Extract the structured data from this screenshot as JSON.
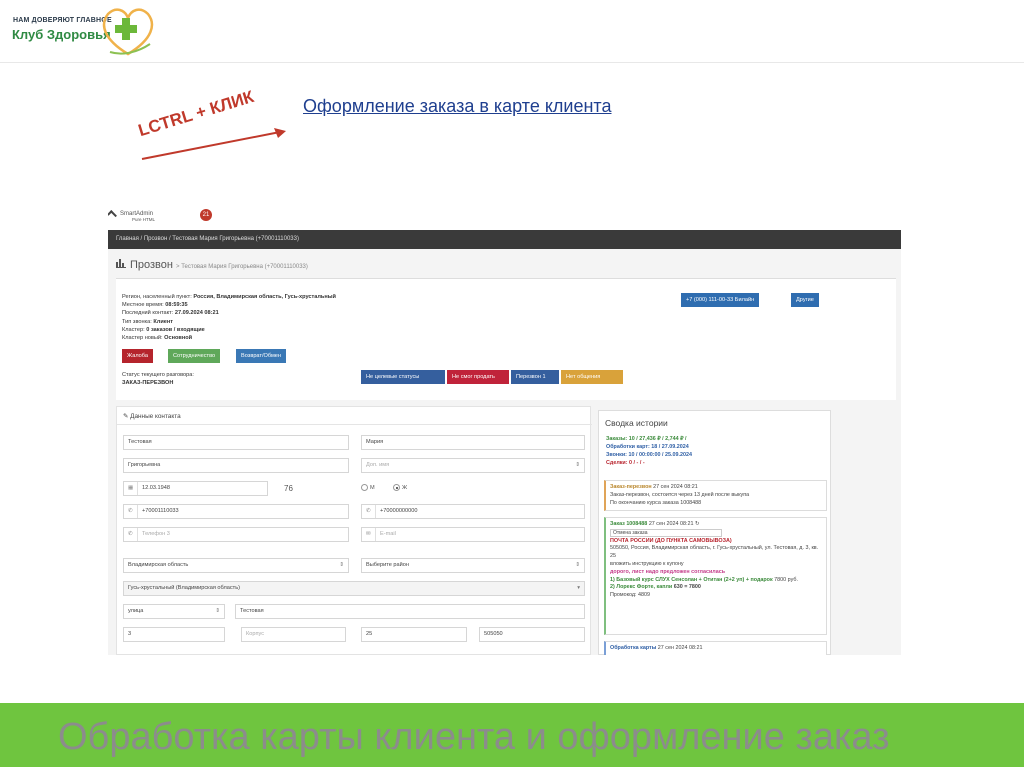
{
  "logo": {
    "top_line": "НАМ ДОВЕРЯЮТ ГЛАВНОЕ",
    "name": "Клуб Здоровья"
  },
  "slide": {
    "link_text": "Оформление заказа в карте клиента",
    "hint_text": "LCTRL + КЛИК",
    "footer_title": "Обработка карты клиента и оформление заказ"
  },
  "app": {
    "brand": "SmartAdmin",
    "brand_sub": "Pure HTML",
    "notif_count": "21",
    "breadcrumb": "Главная / Прозвон / Тестовая Мария Григорьевна (+70001110033)",
    "page_title": "Прозвон",
    "page_sub": "> Тестовая Мария Григорьевна (+70001110033)",
    "info": {
      "region_label": "Регион, населенный пункт:",
      "region_value": "Россия, Владимирская область, Гусь-хрустальный",
      "time_label": "Местное время:",
      "time_value": "08:59:35",
      "last_label": "Последний контакт:",
      "last_value": "27.09.2024 08:21",
      "type_label": "Тип звонка:",
      "type_value": "Клиент",
      "cluster_label": "Кластер:",
      "cluster_value": "0 заказов / входящие",
      "newcluster_label": "Кластер новый:",
      "newcluster_value": "Основной"
    },
    "buttons": {
      "complaint": "Жалоба",
      "cooperation": "Сотрудничество",
      "return": "Возврат/Обмен",
      "call": "+7 (000) 111-00-33 Билайн",
      "other": "Другие"
    },
    "status_label": "Статус текущего разговора:",
    "status_value": "ЗАКАЗ-ПЕРЕЗВОН",
    "status_buttons": {
      "not_target": "Не целевые статусы",
      "failed": "Не смог продать",
      "recall": "Перезвон 1",
      "no_talk": "Нет общения"
    },
    "contact": {
      "title": "Данные контакта",
      "last_name": "Тестовая",
      "first_name": "Мария",
      "patronymic": "Григорьевна",
      "extra_ph": "Доп. имя",
      "birthdate": "12.03.1948",
      "age": "76",
      "sex_m": "М",
      "sex_f": "Ж",
      "phone1": "+70001110033",
      "phone2": "+70000000000",
      "phone3_ph": "Телефон 3",
      "email_ph": "E-mail",
      "region": "Владимирская область",
      "district_ph": "Выберите район",
      "city": "Гусь-хрустальный (Владимирская область)",
      "street_type": "улица",
      "street": "Тестовая",
      "house": "3",
      "corpus_ph": "Корпус",
      "apartment": "25",
      "index": "505050"
    },
    "history": {
      "title": "Сводка истории",
      "orders": "Заказы: 10 / 27,436 ₽ / 2,744 ₽ /",
      "processing": "Обработки карт: 18 / 27.09.2024",
      "calls": "Звонки: 10 / 00:00:00 / 25.09.2024",
      "deals": "Сделки: 0 / - / -",
      "card1_head": "Заказ-перезвон",
      "card1_date": "27 сен 2024 08:21",
      "card1_text1": "Заказ-перезвон, состоится через 13 дней после выкупа",
      "card1_text2": "По окончанию курса заказа 1008488",
      "card2_head": "Заказ 1008488",
      "card2_date": "27 сен 2024 08:21",
      "card2_select": "Отмена заказа",
      "card2_delivery": "ПОЧТА РОССИИ (ДО ПУНКТА САМОВЫВОЗА)",
      "card2_addr": "505050, Россия, Владимирская область, г. Гусь-хрустальный, ул. Тестовая, д. 3, кв. 25",
      "card2_note": "вложить инструкцию к купону",
      "card2_warn": "дорого, лист надо предложен согласилась",
      "card2_item1": "1) Базовый курс СЛУХ Сенсолан + Отитан (2+2 уп) + подарок",
      "card2_item1_price": "7800 руб.",
      "card2_item2": "2) Лорекс Форте, капли",
      "card2_item2_price": "630 = 7800",
      "card2_promo": "Промокод: 4809",
      "card3_head": "Обработка карты",
      "card3_date": "27 сен 2024 08:21"
    }
  }
}
